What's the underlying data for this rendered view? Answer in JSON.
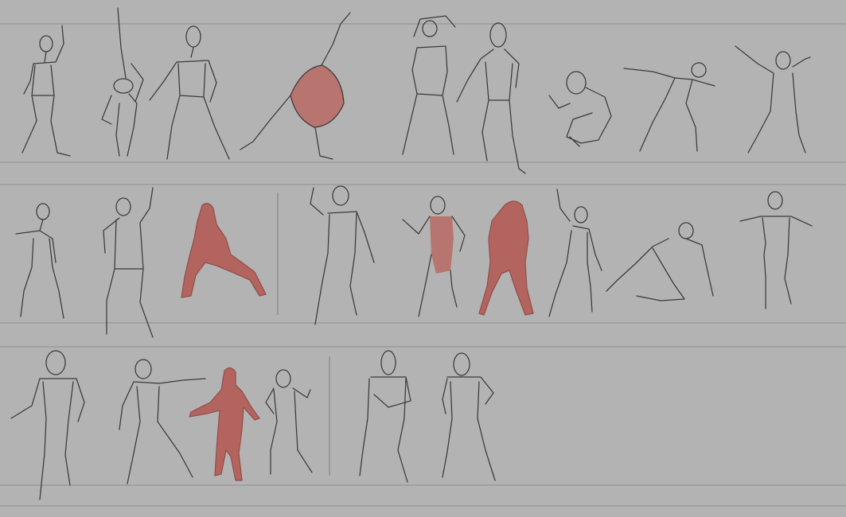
{
  "sheet": {
    "background": "#b3b3b3",
    "ink_color": "#3a3a3a",
    "shade_color": "#b5605a",
    "rows": [
      {
        "figures": [
          {
            "pose": "standing-arm-raised",
            "shaded": false
          },
          {
            "pose": "arm-overhead-twist",
            "shaded": false
          },
          {
            "pose": "contrapposto-standing",
            "shaded": false
          },
          {
            "pose": "lunge-diagonal-reach",
            "shaded": "partial"
          },
          {
            "pose": "arms-overhead-back",
            "shaded": false
          },
          {
            "pose": "back-turned-standing",
            "shaded": false
          },
          {
            "pose": "crouching",
            "shaded": false
          },
          {
            "pose": "bent-forward-reach",
            "shaded": false
          },
          {
            "pose": "throwing-pose",
            "shaded": false
          }
        ]
      },
      {
        "figures": [
          {
            "pose": "side-standing",
            "shaded": false
          },
          {
            "pose": "arm-raised-standing",
            "shaded": false
          },
          {
            "pose": "wide-lunge-hands-on-knees",
            "shaded": "full"
          },
          {
            "pose": "flexing-walk",
            "shaded": false
          },
          {
            "pose": "hands-on-hips-front",
            "shaded": "partial"
          },
          {
            "pose": "back-view-hands-behind",
            "shaded": "full"
          },
          {
            "pose": "arm-up-profile",
            "shaded": false
          },
          {
            "pose": "reclining-seated",
            "shaded": false
          },
          {
            "pose": "back-view-arms-out",
            "shaded": false
          }
        ]
      },
      {
        "figures": [
          {
            "pose": "muscular-front",
            "shaded": false
          },
          {
            "pose": "pointing-reach",
            "shaded": false
          },
          {
            "pose": "standing-arms-out",
            "shaded": "full"
          },
          {
            "pose": "fists-raised",
            "shaded": false
          },
          {
            "pose": "arms-crossed-front",
            "shaded": false
          },
          {
            "pose": "hand-on-hip-front",
            "shaded": false
          }
        ]
      }
    ]
  }
}
